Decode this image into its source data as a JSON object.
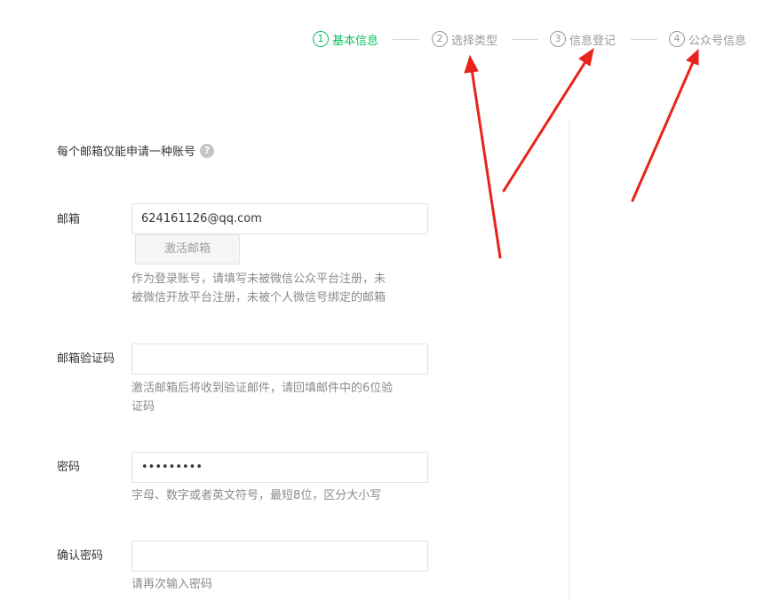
{
  "steps": [
    {
      "num": "1",
      "label": "基本信息",
      "active": true
    },
    {
      "num": "2",
      "label": "选择类型",
      "active": false
    },
    {
      "num": "3",
      "label": "信息登记",
      "active": false
    },
    {
      "num": "4",
      "label": "公众号信息",
      "active": false
    }
  ],
  "notice": "每个邮箱仅能申请一种账号",
  "help_icon": "?",
  "email": {
    "label": "邮箱",
    "value": "624161126@qq.com",
    "activate_button": "激活邮箱",
    "hint_line1": "作为登录账号，请填写未被微信公众平台注册，未",
    "hint_line2": "被微信开放平台注册，未被个人微信号绑定的邮箱"
  },
  "verify_code": {
    "label": "邮箱验证码",
    "value": "",
    "hint_line1": "激活邮箱后将收到验证邮件，请回填邮件中的6位验",
    "hint_line2": "证码"
  },
  "password": {
    "label": "密码",
    "value": "•••••••••",
    "hint": "字母、数字或者英文符号，最短8位，区分大小写"
  },
  "confirm_password": {
    "label": "确认密码",
    "value": "",
    "hint": "请再次输入密码"
  },
  "colors": {
    "accent": "#07c160",
    "annotation_arrow": "#e8231b"
  }
}
